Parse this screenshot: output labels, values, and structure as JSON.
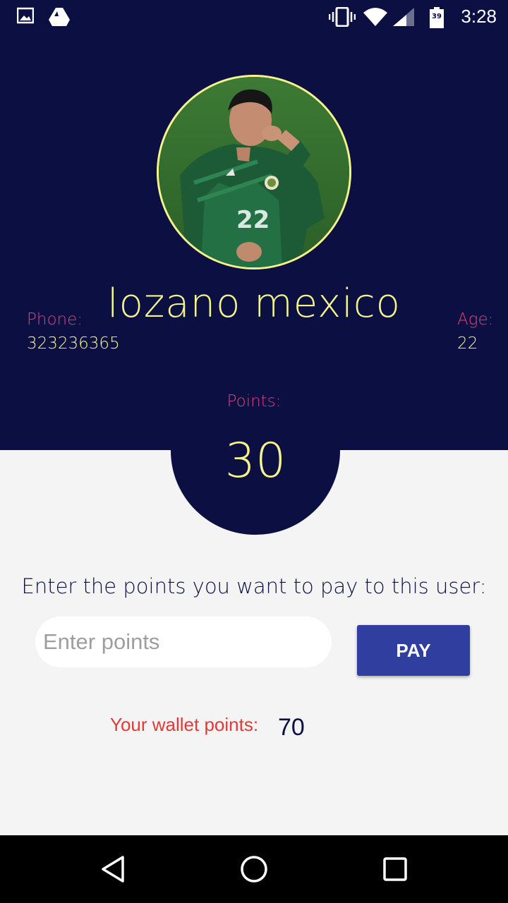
{
  "status_bar": {
    "time": "3:28",
    "battery_level": "39",
    "icons": [
      "image-icon",
      "drive-icon",
      "vibrate-icon",
      "wifi-icon",
      "signal-icon",
      "battery-icon"
    ]
  },
  "profile": {
    "name": "lozano mexico",
    "phone_label": "Phone:",
    "phone_value": "323236365",
    "age_label": "Age:",
    "age_value": "22",
    "points_label": "Points:",
    "points_value": "30",
    "jersey_number": "22"
  },
  "payment": {
    "prompt": "Enter the points you want to pay to this user:",
    "input_placeholder": "Enter points",
    "input_value": "",
    "pay_label": "PAY",
    "wallet_label": "Your wallet points:",
    "wallet_value": "70"
  },
  "nav": {
    "icons": [
      "back-icon",
      "home-icon",
      "recents-icon"
    ]
  },
  "colors": {
    "header_bg": "#0b0f42",
    "accent_yellow": "#f6f58c",
    "label_pink": "#e0407c",
    "pay_button": "#303f9f",
    "wallet_label": "#e53935"
  }
}
